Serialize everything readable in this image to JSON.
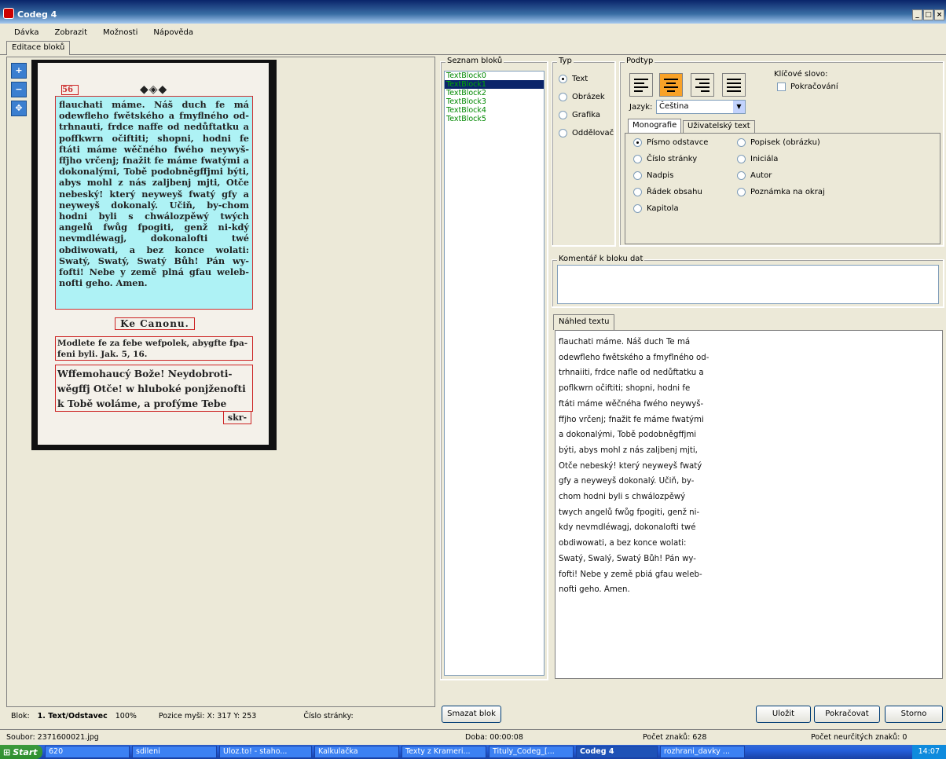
{
  "window": {
    "title": "Codeg 4",
    "buttons": [
      "_",
      "□",
      "×"
    ]
  },
  "menu": [
    "Dávka",
    "Zobrazit",
    "Možnosti",
    "Nápověda"
  ],
  "tab": "Editace bloků",
  "tools": [
    "zoom-in",
    "zoom-out",
    "fit"
  ],
  "scan": {
    "page_no": "56",
    "block0": "flauchati máme. Náš duch fe má odewfleho fwětského a fmyflného od-trhnauti, frdce naffe od nedůftatku a poffkwrn očiftiti; shopni, hodni fe ftáti máme wěčného fwého neywyš-ffjho vrčenj; fnažit fe máme fwatými a dokonalými, Tobě podobněgffjmi býti, abys mohl z nás zaljbenj mjti, Otče nebeský! který neyweyš fwatý gfy a neyweyš dokonalý. Učiň, by-chom hodni byli s chwálozpěwý twých angelů fwůg fpogiti, genž ni-kdý nevmdléwagj, dokonalofti twé obdiwowati, a bez konce wolati: Swatý, Swatý, Swatý Bůh! Pán wy-fofti! Nebe y země plná gfau weleb-nofti geho. Amen.",
    "heading": "Ke Canonu.",
    "block2": "Modlete fe za febe wefpolek, abygfte fpa-feni byli. Jak. 5, 16.",
    "block3": "Wffemohaucý Bože! Neydobroti-wěgffj Otče! w hluboké ponjženofti k Tobě woláme, a profýme Tebe",
    "block_end": "skr-"
  },
  "blocks": {
    "label": "Seznam bloků",
    "items": [
      "TextBlock0",
      "TextBlock1",
      "TextBlock2",
      "TextBlock3",
      "TextBlock4",
      "TextBlock5"
    ],
    "selected": 1
  },
  "typ": {
    "label": "Typ",
    "options": [
      "Text",
      "Obrázek",
      "Grafika",
      "Oddělovač"
    ],
    "selected": 0
  },
  "podtyp": {
    "label": "Podtyp",
    "jazyk_label": "Jazyk:",
    "jazyk": "Čeština",
    "keyword_label": "Klíčové slovo:",
    "continue_label": "Pokračování",
    "tabs": [
      "Monografie",
      "Uživatelský text"
    ],
    "col1": [
      "Písmo odstavce",
      "Číslo stránky",
      "Nadpis",
      "Řádek obsahu",
      "Kapitola"
    ],
    "col2": [
      "Popisek (obrázku)",
      "Iniciála",
      "Autor",
      "Poznámka na okraj"
    ]
  },
  "comment_label": "Komentář k bloku dat",
  "preview_tab": "Náhled textu",
  "preview_text": "flauchati máme. Náš duch Te má\nodewfleho fwětského a fmyflného od-\ntrhnaiiti, frdce nafle od nedůftatku a\npoflkwrn očiftiti; shopni, hodni fe\nftáti máme wěčnéha fwého neywyš-\nffjho vrčenj; fnažit fe máme fwatými\na dokonalými, Tobě podobněgffjmi\nbýti, abys mohl z nás zaljbenj mjti,\nOtče nebeský! který neyweyš fwatý\ngfy a neyweyš dokonalý. Učiň, by-\nchom hodni byli s chwálozpěwý\ntwych angelů fwůg fpogiti, genž ni-\nkdy nevmdléwagj, dokonalofti twé\nobdiwowati, a bez konce wolati:\nSwatý, Swalý, Swatý Bůh! Pán wy-\nfofti! Nebe y země pbiá gfau weleb-\nnofti geho. Amen.",
  "buttons": {
    "delete": "Smazat blok",
    "save": "Uložit",
    "continue": "Pokračovat",
    "cancel": "Storno"
  },
  "info": {
    "blok_label": "Blok:",
    "blok_value": "1. Text/Odstavec",
    "zoom": "100%",
    "mouse": "Pozice myši: X: 317 Y: 253",
    "page_label": "Číslo stránky:"
  },
  "status": {
    "file": "Soubor: 2371600021.jpg",
    "time": "Doba: 00:00:08",
    "chars": "Počet znaků: 628",
    "uncertain": "Počet neurčitých znaků: 0"
  },
  "taskbar": {
    "start": "Start",
    "items": [
      "620",
      "sdileni",
      "Uloz.to! - staho...",
      "Kalkulačka",
      "Texty z Krameri...",
      "Tituly_Codeg_[...",
      "Codeg 4",
      "rozhrani_davky ..."
    ],
    "active": 6,
    "clock": "14:07"
  }
}
